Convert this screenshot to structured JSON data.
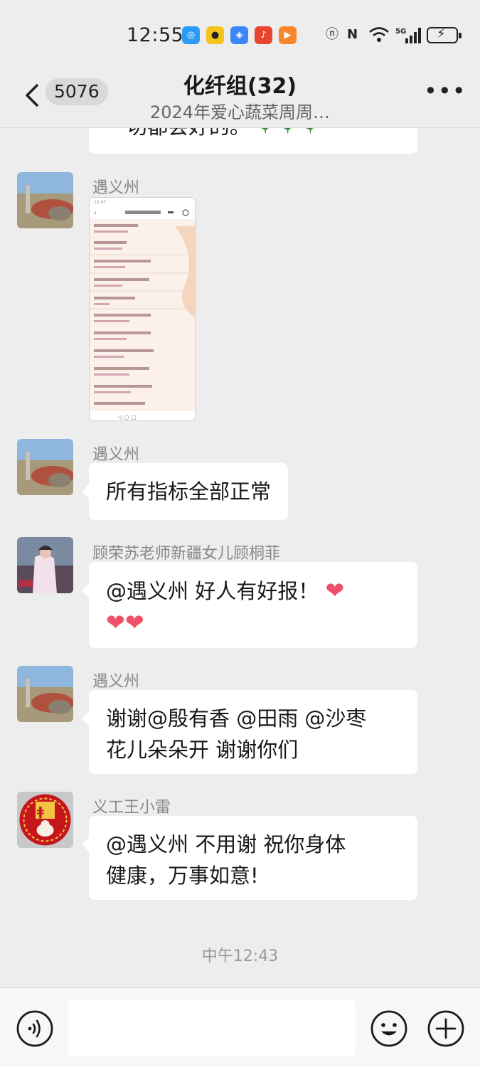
{
  "status_bar": {
    "time": "12:55",
    "network": "5G"
  },
  "header": {
    "unread_count": "5076",
    "title": "化纤组(32)",
    "subtitle": "2024年爱心蔬菜周周…"
  },
  "messages": [
    {
      "type": "text",
      "text": "一切都会好的。"
    },
    {
      "type": "image",
      "sender": "遇义州"
    },
    {
      "type": "text",
      "sender": "遇义州",
      "text": "所有指标全部正常"
    },
    {
      "type": "text",
      "sender": "顾荣苏老师新疆女儿顾桐菲",
      "text": "@遇义州  好人有好报！"
    },
    {
      "type": "text",
      "sender": "遇义州",
      "line1": "谢谢@殷有香 @田雨 @沙枣",
      "line2": "花儿朵朵开  谢谢你们"
    },
    {
      "type": "text",
      "sender": "义工王小雷",
      "line1": "@遇义州  不用谢  祝你身体",
      "line2": "健康，万事如意!"
    }
  ],
  "timestamp": "中午12:43",
  "input": {
    "placeholder": ""
  },
  "colors": {
    "background": "#ededed",
    "bubble": "#ffffff",
    "heart": "#f0516a"
  }
}
